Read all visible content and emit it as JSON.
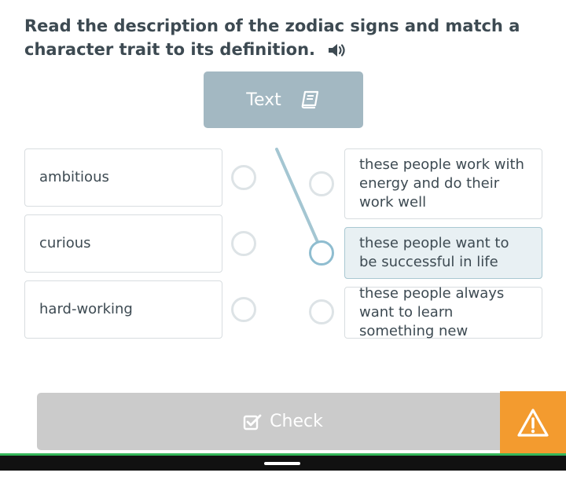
{
  "instruction": "Read the description of the zodiac signs and match a character trait to its definition.",
  "text_button": {
    "label": "Text",
    "icon": "book-icon"
  },
  "left_items": [
    {
      "label": "ambitious"
    },
    {
      "label": "curious"
    },
    {
      "label": "hard-working"
    }
  ],
  "right_items": [
    {
      "label": "these people work with energy and do their work well"
    },
    {
      "label": "these people want to be successful in life",
      "selected": true
    },
    {
      "label": "these people always want to learn something new"
    }
  ],
  "check_button": {
    "label": "Check",
    "icon": "checkbox-icon"
  },
  "colors": {
    "text": "#3d4a52",
    "text_button_bg": "#a3b8c2",
    "selected_card_bg": "#e8f0f3",
    "connector": "#a4c6d2",
    "check_bg": "#cbcbcb",
    "warning_bg": "#f39b2f",
    "progress_green": "#35b65a"
  },
  "icons": {
    "audio": "speaker-icon",
    "warning": "warning-icon"
  }
}
